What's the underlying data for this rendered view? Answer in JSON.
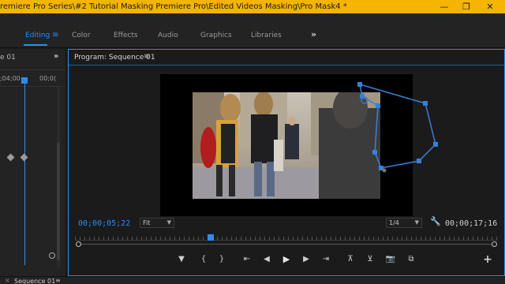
{
  "window": {
    "title": "remiere Pro Series\\#2 Tutorial Masking Premiere Pro\\Edited Videos Masking\\Pro Mask4 *",
    "minimize_glyph": "—",
    "maximize_glyph": "❐",
    "close_glyph": "✕",
    "bar_color": "#f5b400"
  },
  "workspaces": {
    "items": [
      "Editing",
      "Color",
      "Effects",
      "Audio",
      "Graphics",
      "Libraries"
    ],
    "active": "Editing",
    "menu_glyph": "≡",
    "more_glyph": "»",
    "accent": "#2d8ceb"
  },
  "left_panel": {
    "tab_label": "e 01",
    "more_glyph": "»",
    "ruler_times": [
      ";04;00",
      "00;0("
    ]
  },
  "program_monitor": {
    "title": "Program: Sequence 01",
    "menu_glyph": "≡",
    "current_timecode": "00;00;05;22",
    "zoom_select": "Fit",
    "resolution_select": "1/4",
    "duration_timecode": "00;00;17;16",
    "playhead_position": 0.32,
    "transport": {
      "add_marker": "▼",
      "mark_in": "{",
      "mark_out": "}",
      "go_to_in": "⇤",
      "step_back": "◀",
      "play": "▶",
      "step_forward": "▶",
      "go_to_out": "⇥",
      "lift": "⊼",
      "extract": "⊻",
      "export_frame": "📷",
      "comparison": "⧉",
      "button_editor": "+"
    },
    "mask_color": "#3a7fd6"
  },
  "bottom_panel": {
    "tab_label": "Sequence 01",
    "close_glyph": "×",
    "menu_glyph": "≡"
  }
}
